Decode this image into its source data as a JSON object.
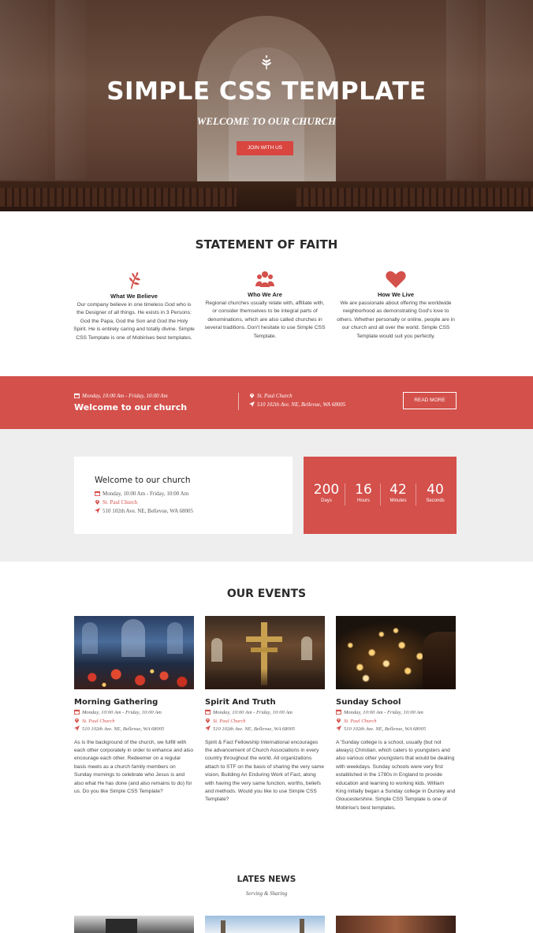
{
  "hero": {
    "title": "SIMPLE CSS TEMPLATE",
    "subtitle": "WELCOME TO OUR CHURCH",
    "button": "JOIN WITH US",
    "icon": "leaf-icon"
  },
  "faith": {
    "title": "STATEMENT OF FAITH",
    "items": [
      {
        "icon": "leaf-icon",
        "heading": "What We Believe",
        "text": "Our company believe in one timeless God who is the Designer of all things. He exists in 3 Persons: God the Papa, God the Son and God the Holy Spirit. He is entirely caring and totally divine. Simple CSS Template is one of Mobirises best templates."
      },
      {
        "icon": "users-icon",
        "heading": "Who We Are",
        "text": "Regional churches usually relate with, affiliate with, or consider themselves to be integral parts of denominations, which are also called churches in several traditions. Don't hesitate to use Simple CSS Template."
      },
      {
        "icon": "heart-icon",
        "heading": "How We Live",
        "text": "We are passionate about offering the worldwide neighborhood as demonstrating God's love to others. Whether personally or online, people are in our church and all over the world. Simple CSS Template would suit you perfectly."
      }
    ]
  },
  "banner": {
    "date": "Monday, 10:00 Am - Friday, 10:00 Am",
    "title": "Welcome to our church",
    "place": "St. Paul Church",
    "address": "510 102th Ave. NE, Bellevue, WA 68005",
    "button": "READ MORE"
  },
  "countdown": {
    "title": "Welcome to our church",
    "date": "Monday, 10:00 Am - Friday, 10:00 Am",
    "place": "St. Paul Church",
    "address": "510 102th Ave. NE, Bellevue, WA 68005",
    "units": [
      {
        "value": "200",
        "label": "Days"
      },
      {
        "value": "16",
        "label": "Hours"
      },
      {
        "value": "42",
        "label": "Minutes"
      },
      {
        "value": "40",
        "label": "Seconds"
      }
    ]
  },
  "events": {
    "title": "OUR EVENTS",
    "items": [
      {
        "title": "Morning Gathering",
        "date": "Monday, 10:00 Am - Friday, 10:00 Am",
        "place": "St. Paul Church",
        "address": "510 102th Ave. NE, Bellevue, WA 68005",
        "text": "As is the background of the church, we fulfill with each other corporately in order to enhance and also encourage each other. Redeemer on a regular basis meets as a church family members on Sunday mornings to celebrate who Jesus is and also what He has done (and also remains to do) for us. Do you like Simple CSS Template?"
      },
      {
        "title": "Spirit And Truth",
        "date": "Monday, 10:00 Am - Friday, 10:00 Am",
        "place": "St. Paul Church",
        "address": "510 102th Ave. NE, Bellevue, WA 68005",
        "text": "Spirit & Fact Fellowship International encourages the advancement of Church Associations in every country throughout the world. All organizations attach to STF on the basis of sharing the very same vision, Building An Enduring Work of Fact, along with having the very same function, worths, beliefs and methods. Would you like to use Simple CSS Template?"
      },
      {
        "title": "Sunday School",
        "date": "Monday, 10:00 Am - Friday, 10:00 Am",
        "place": "St. Paul Church",
        "address": "510 102th Ave. NE, Bellevue, WA 68005",
        "text": "A 'Sunday college is a school, usually (but not always) Christian, which caters to youngsters and also various other youngsters that would be dealing with weekdays. Sunday schools were very first established in the 1780s in England to provide education and learning to working kids. William King initially began a Sunday college in Dursley and Gloucestershire. Simple CSS Template is one of Mobirise's best templates."
      }
    ]
  },
  "news": {
    "title": "LATES NEWS",
    "subtitle": "Serving & Sharing"
  },
  "colors": {
    "accent": "#d4504b",
    "gray_band": "#eeeeee"
  }
}
